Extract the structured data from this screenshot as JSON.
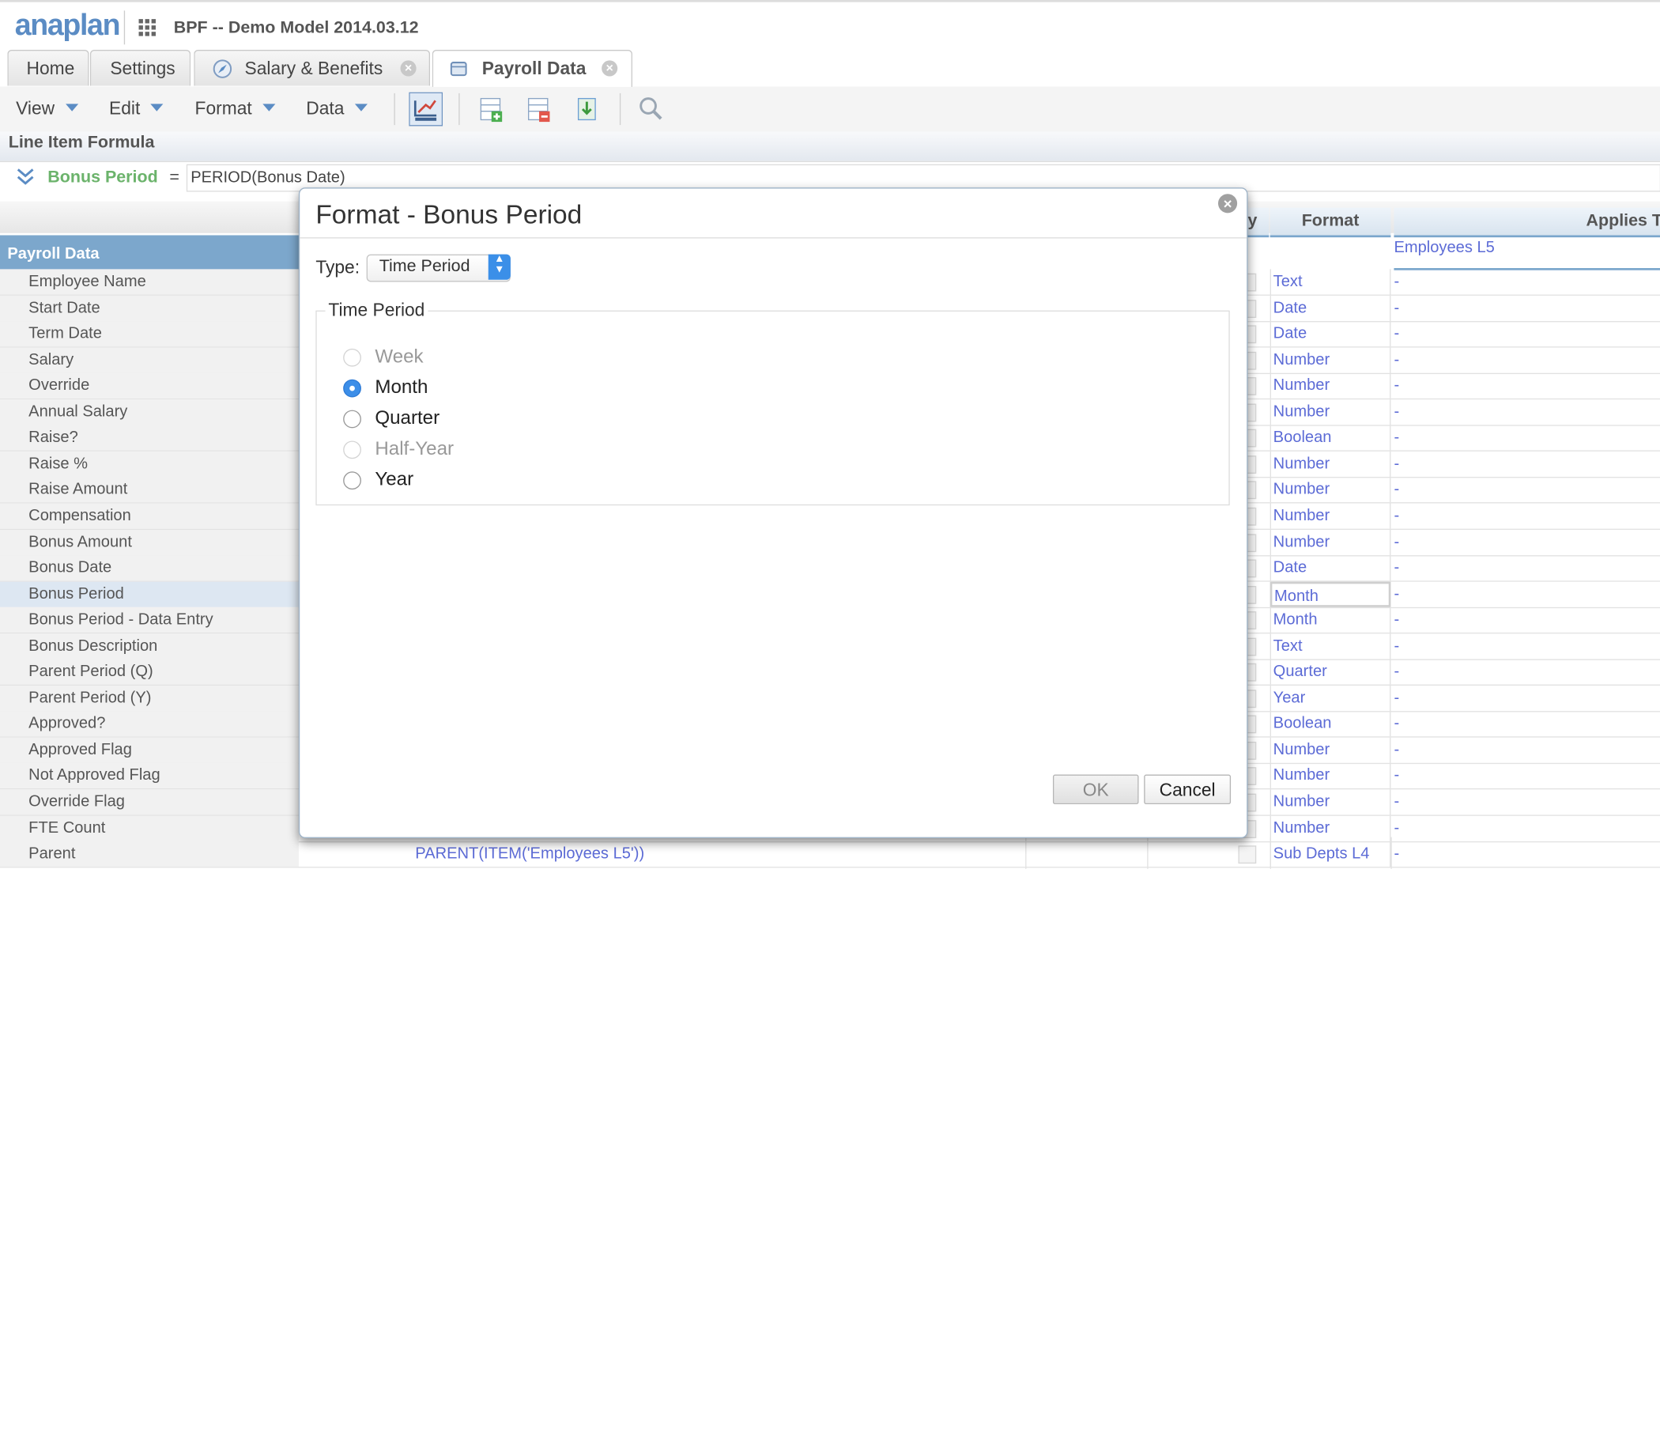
{
  "app": {
    "logo": "anaplan",
    "model_title": "BPF -- Demo Model 2014.03.12"
  },
  "tabs": [
    {
      "label": "Home"
    },
    {
      "label": "Settings"
    },
    {
      "label": "Salary & Benefits",
      "closable": true,
      "icon": "compass-icon"
    },
    {
      "label": "Payroll Data",
      "closable": true,
      "icon": "module-icon",
      "active": true
    }
  ],
  "menus": {
    "view": "View",
    "edit": "Edit",
    "format": "Format",
    "data": "Data"
  },
  "toolbar_icons": [
    "blueprint-icon",
    "insert-row-icon",
    "delete-row-icon",
    "import-icon",
    "search-icon"
  ],
  "formula": {
    "section_title": "Line Item Formula",
    "line_item": "Bonus Period",
    "equals": "=",
    "expression": "PERIOD(Bonus Date)"
  },
  "grid": {
    "row_header_title": "Payroll Data",
    "columns": {
      "partial": "y",
      "format": "Format",
      "applies_to": "Applies To"
    },
    "applies_to_default": "Employees L5",
    "rows": [
      {
        "name": "Employee Name",
        "format": "Text",
        "applies": "-"
      },
      {
        "name": "Start Date",
        "format": "Date",
        "applies": "-"
      },
      {
        "name": "Term Date",
        "format": "Date",
        "applies": "-"
      },
      {
        "name": "Salary",
        "format": "Number",
        "applies": "-"
      },
      {
        "name": "Override",
        "format": "Number",
        "applies": "-"
      },
      {
        "name": "Annual Salary",
        "format": "Number",
        "applies": "-"
      },
      {
        "name": "Raise?",
        "format": "Boolean",
        "applies": "-"
      },
      {
        "name": "Raise %",
        "format": "Number",
        "applies": "-"
      },
      {
        "name": "Raise Amount",
        "format": "Number",
        "applies": "-"
      },
      {
        "name": "Compensation",
        "format": "Number",
        "applies": "-"
      },
      {
        "name": "Bonus Amount",
        "format": "Number",
        "applies": "-"
      },
      {
        "name": "Bonus Date",
        "format": "Date",
        "applies": "-"
      },
      {
        "name": "Bonus Period",
        "format": "Month",
        "applies": "-",
        "selected": true
      },
      {
        "name": "Bonus Period - Data Entry",
        "format": "Month",
        "applies": "-"
      },
      {
        "name": "Bonus Description",
        "format": "Text",
        "applies": "-"
      },
      {
        "name": "Parent Period (Q)",
        "format": "Quarter",
        "applies": "-"
      },
      {
        "name": "Parent Period (Y)",
        "format": "Year",
        "applies": "-"
      },
      {
        "name": "Approved?",
        "format": "Boolean",
        "applies": "-"
      },
      {
        "name": "Approved Flag",
        "format": "Number",
        "applies": "-"
      },
      {
        "name": "Not Approved Flag",
        "format": "Number",
        "applies": "-"
      },
      {
        "name": "Override Flag",
        "format": "Number",
        "applies": "-"
      },
      {
        "name": "FTE Count",
        "format": "Number",
        "applies": "-"
      },
      {
        "name": "Parent",
        "format": "Sub Depts L4",
        "applies": "-",
        "formula": "PARENT(ITEM('Employees L5'))"
      }
    ]
  },
  "dialog": {
    "title": "Format - Bonus Period",
    "type_label": "Type:",
    "type_value": "Time Period",
    "group_label": "Time Period",
    "options": [
      {
        "label": "Week",
        "disabled": true,
        "checked": false
      },
      {
        "label": "Month",
        "disabled": false,
        "checked": true
      },
      {
        "label": "Quarter",
        "disabled": false,
        "checked": false
      },
      {
        "label": "Half-Year",
        "disabled": true,
        "checked": false
      },
      {
        "label": "Year",
        "disabled": false,
        "checked": false
      }
    ],
    "ok_label": "OK",
    "cancel_label": "Cancel"
  }
}
